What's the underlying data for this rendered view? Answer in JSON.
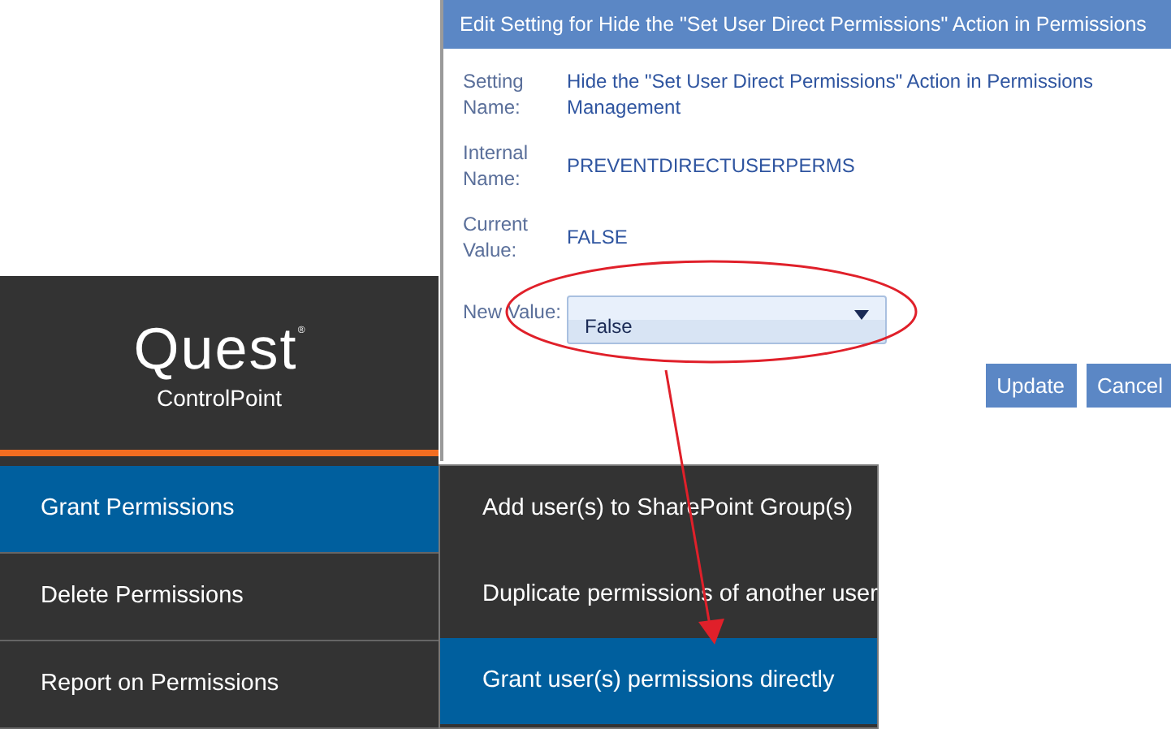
{
  "dialog": {
    "title": "Edit Setting for Hide the \"Set User Direct Permissions\" Action in Permissions",
    "fields": [
      {
        "label": "Setting Name:",
        "value": "Hide the \"Set User Direct Permissions\" Action in Permissions Management"
      },
      {
        "label": "Internal Name:",
        "value": "PREVENTDIRECTUSERPERMS"
      },
      {
        "label": "Current Value:",
        "value": "FALSE"
      }
    ],
    "new_value": {
      "label": "New Value:",
      "value": "False"
    },
    "buttons": [
      "Update",
      "Cancel"
    ]
  },
  "logo": {
    "wordmark": "Quest",
    "mark": "®",
    "product": "ControlPoint"
  },
  "nav": [
    {
      "label": "Grant Permissions",
      "selected": true
    },
    {
      "label": "Delete Permissions",
      "selected": false
    },
    {
      "label": "Report on Permissions",
      "selected": false
    }
  ],
  "submenu": [
    {
      "label": "Add user(s) to SharePoint Group(s)",
      "selected": false
    },
    {
      "label": "Duplicate permissions of another user",
      "selected": false
    },
    {
      "label": "Grant user(s) permissions directly",
      "selected": true
    }
  ]
}
